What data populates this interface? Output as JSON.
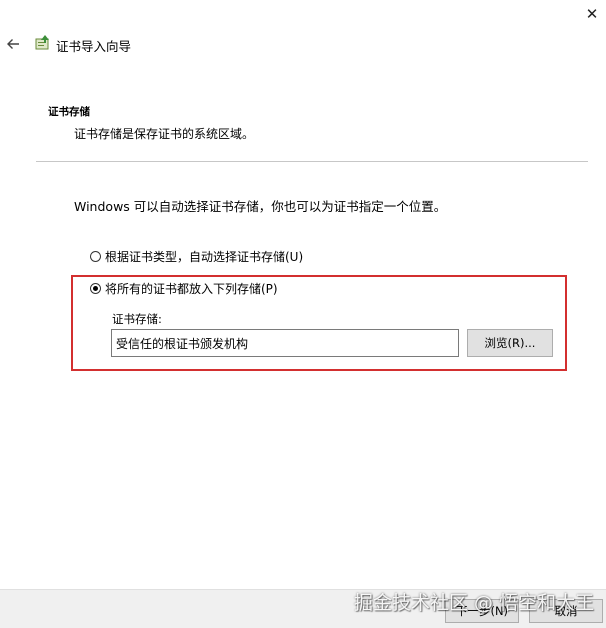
{
  "window": {
    "close_symbol": "✕",
    "title": "证书导入向导"
  },
  "section": {
    "title": "证书存储",
    "description": "证书存储是保存证书的系统区域。"
  },
  "intro": "Windows 可以自动选择证书存储，你也可以为证书指定一个位置。",
  "options": {
    "auto": {
      "label": "根据证书类型，自动选择证书存储(U)",
      "checked": false
    },
    "manual": {
      "label": "将所有的证书都放入下列存储(P)",
      "checked": true
    }
  },
  "store": {
    "label": "证书存储:",
    "value": "受信任的根证书颁发机构",
    "browse_label": "浏览(R)..."
  },
  "footer": {
    "next_label": "下一步(N)",
    "cancel_label": "取消"
  },
  "watermark": "掘金技术社区 @ 悟空和大王",
  "colors": {
    "highlight_border": "#d32f2f",
    "footer_bg": "#f0f0f0"
  },
  "icons": {
    "back": "arrow-left-icon",
    "wizard": "certificate-wizard-icon"
  }
}
